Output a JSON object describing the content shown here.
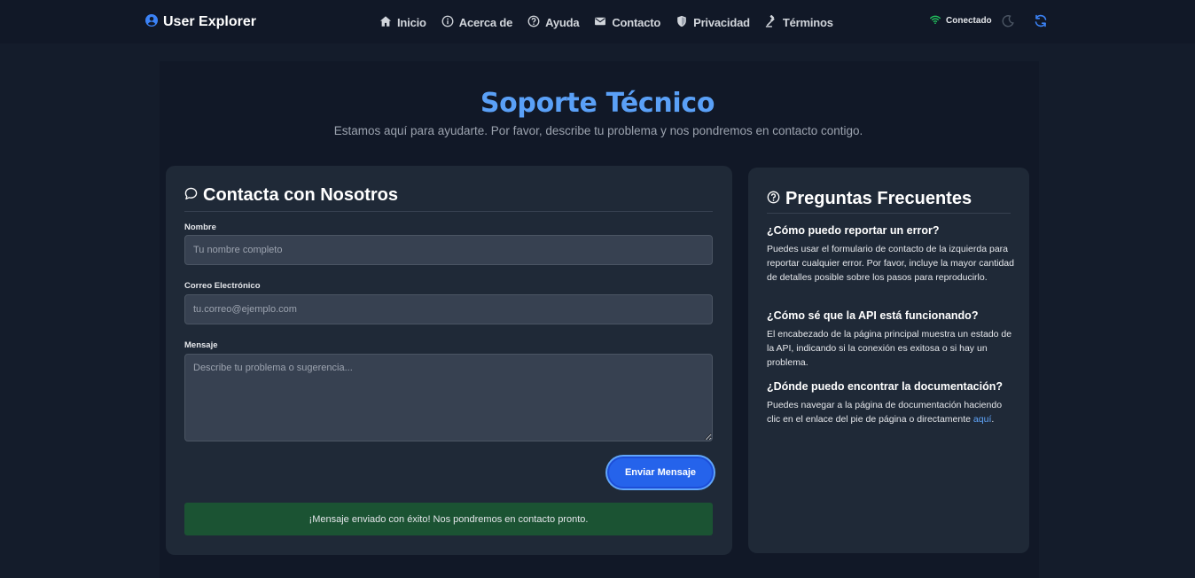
{
  "app": {
    "brand": "User Explorer"
  },
  "nav": {
    "items": [
      {
        "label": "Inicio",
        "icon": "home-icon"
      },
      {
        "label": "Acerca de",
        "icon": "info-icon"
      },
      {
        "label": "Ayuda",
        "icon": "help-icon"
      },
      {
        "label": "Contacto",
        "icon": "mail-icon"
      },
      {
        "label": "Privacidad",
        "icon": "shield-icon"
      },
      {
        "label": "Términos",
        "icon": "gavel-icon"
      }
    ],
    "status": "Conectado",
    "status_color": "#22c55e",
    "accent": "#3b82f6"
  },
  "page": {
    "title": "Soporte Técnico",
    "subtitle": "Estamos aquí para ayudarte. Por favor, describe tu problema y nos pondremos en contacto contigo."
  },
  "contact": {
    "title": "Contacta con Nosotros",
    "name_label": "Nombre",
    "name_placeholder": "Tu nombre completo",
    "name_value": "",
    "email_label": "Correo Electrónico",
    "email_placeholder": "tu.correo@ejemplo.com",
    "email_value": "",
    "message_label": "Mensaje",
    "message_placeholder": "Describe tu problema o sugerencia...",
    "message_value": "",
    "send_label": "Enviar Mensaje",
    "success_message": "¡Mensaje enviado con éxito! Nos pondremos en contacto pronto."
  },
  "faq": {
    "title": "Preguntas Frecuentes",
    "items": [
      {
        "question": "¿Cómo puedo reportar un error?",
        "answer": "Puedes usar el formulario de contacto de la izquierda para reportar cualquier error. Por favor, incluye la mayor cantidad de detalles posible sobre los pasos para reproducirlo."
      },
      {
        "question": "¿Cómo sé que la API está funcionando?",
        "answer": "El encabezado de la página principal muestra un estado de la API, indicando si la conexión es exitosa o si hay un problema."
      },
      {
        "question": "¿Dónde puedo encontrar la documentación?",
        "answer": "Puedes navegar a la página de documentación haciendo clic en el enlace del pie de página o directamente",
        "link_text": "aquí",
        "answer_end": "."
      }
    ]
  }
}
